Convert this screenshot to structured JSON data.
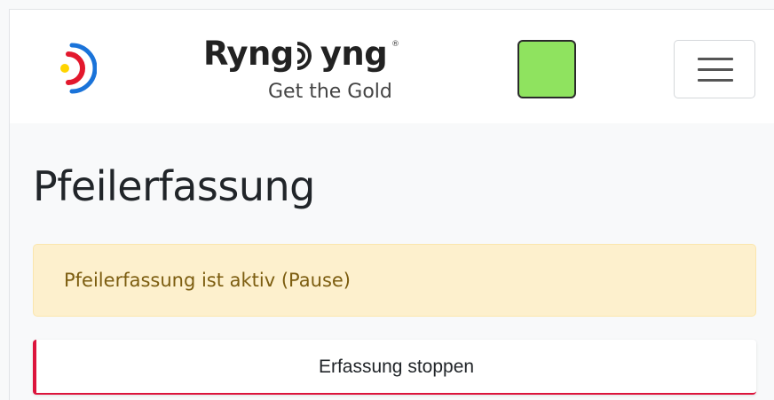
{
  "brand": {
    "name_part1": "Ryng",
    "name_part2": "yng",
    "registered_mark": "®",
    "tagline": "Get the Gold"
  },
  "status_indicator": {
    "color": "#8fe35f",
    "icon": "status-square"
  },
  "navbar": {
    "toggler_icon": "hamburger-menu"
  },
  "page": {
    "title": "Pfeilerfassung",
    "alert_text": "Pfeilerfassung ist aktiv (Pause)",
    "stop_button_label": "Erfassung stoppen"
  },
  "colors": {
    "accent_red": "#dc143c",
    "alert_bg": "#fdf0cd",
    "target_yellow": "#ffd400",
    "target_red": "#e3182d",
    "target_blue": "#1a73d9"
  }
}
